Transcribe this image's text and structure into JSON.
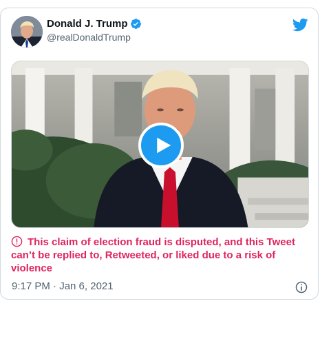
{
  "tweet": {
    "display_name": "Donald J. Trump",
    "handle": "@realDonaldTrump",
    "notice": "This claim of election fraud is disputed, and this Tweet can’t be replied to, Retweeted, or liked due to a risk of violence",
    "timestamp": "9:17 PM · Jan 6, 2021"
  },
  "colors": {
    "brand": "#1d9bf0",
    "warning": "#e0245e",
    "muted": "#536471"
  },
  "icons": [
    "verified-badge-icon",
    "twitter-bird-icon",
    "play-icon",
    "warning-circle-icon",
    "info-icon"
  ]
}
